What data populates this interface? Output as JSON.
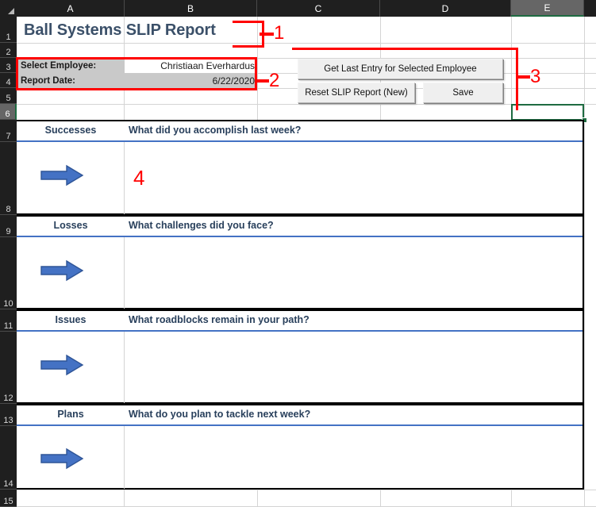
{
  "app": {
    "type": "spreadsheet",
    "columns": [
      "A",
      "B",
      "C",
      "D",
      "E"
    ],
    "selected_column": "E",
    "selected_cell": "E6",
    "rows": [
      "1",
      "2",
      "3",
      "4",
      "5",
      "6",
      "7",
      "8",
      "9",
      "10",
      "11",
      "12",
      "13",
      "14",
      "15"
    ]
  },
  "report": {
    "title": "Ball Systems SLIP Report",
    "fields": [
      {
        "label": "Select Employee:",
        "value": "Christiaan Everhardus"
      },
      {
        "label": "Report Date:",
        "value": "6/22/2020"
      }
    ]
  },
  "buttons": {
    "get_last_entry": "Get Last Entry for Selected Employee",
    "reset": "Reset SLIP Report (New)",
    "save": "Save"
  },
  "sections": [
    {
      "name": "Successes",
      "question": "What did you accomplish last week?",
      "answer": ""
    },
    {
      "name": "Losses",
      "question": "What challenges did you face?",
      "answer": ""
    },
    {
      "name": "Issues",
      "question": "What roadblocks remain in your path?",
      "answer": ""
    },
    {
      "name": "Plans",
      "question": "What do you plan to tackle next week?",
      "answer": ""
    }
  ],
  "annotations": [
    {
      "id": "1",
      "label": "1",
      "target": "report title"
    },
    {
      "id": "2",
      "label": "2",
      "target": "employee and date fields"
    },
    {
      "id": "3",
      "label": "3",
      "target": "macro buttons"
    },
    {
      "id": "4",
      "label": "4",
      "target": "answer entry area"
    }
  ],
  "colors": {
    "header_text": "#3b5069",
    "section_text": "#29405c",
    "accent_blue": "#4472c4",
    "arrow_fill": "#4472c4",
    "annotation_red": "#ff0000",
    "selection_green": "#1e6b41",
    "shade_gray": "#c9c9c9"
  }
}
